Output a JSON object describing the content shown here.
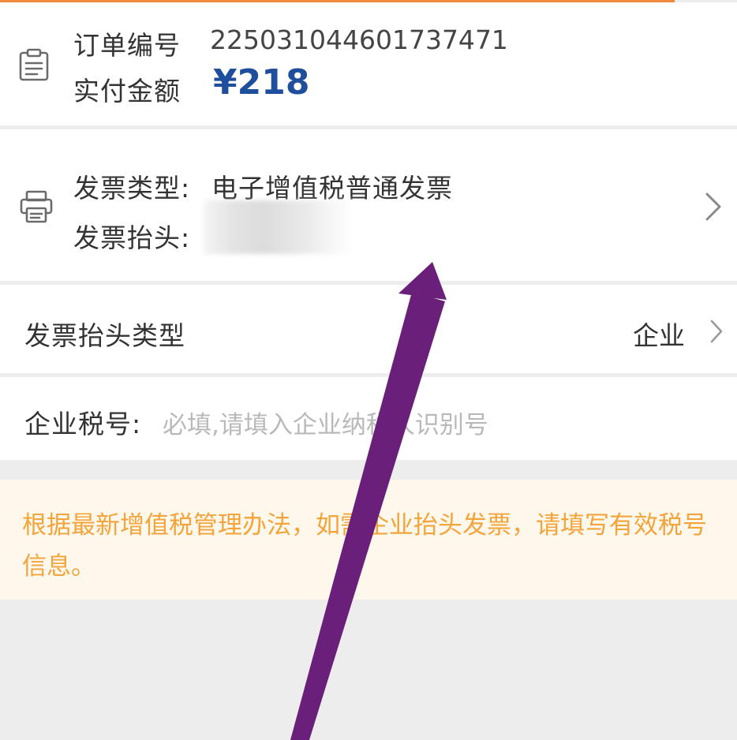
{
  "order": {
    "number_label": "订单编号",
    "number_value": "2250310446017374",
    "number_suffix": "71",
    "amount_label": "实付金额",
    "amount_value": "¥218"
  },
  "invoice": {
    "type_label": "发票类型:",
    "type_value": "电子增值税普通发票",
    "header_label": "发票抬头:"
  },
  "header_type": {
    "label": "发票抬头类型",
    "value": "企业"
  },
  "tax_id": {
    "label": "企业税号:",
    "placeholder": "必填,请填入企业纳税人识别号"
  },
  "notice": {
    "text": "根据最新增值税管理办法，如需企业抬头发票，请填写有效税号信息。"
  },
  "colors": {
    "accent_orange": "#f08a3c",
    "amount_blue": "#1f4f9c",
    "notice_text": "#f3a43a",
    "notice_bg": "#fdf7ec",
    "annotation_arrow": "#6a1f7a"
  },
  "icons": {
    "order": "clipboard-icon",
    "invoice": "printer-icon",
    "chevron": "chevron-right-icon"
  }
}
